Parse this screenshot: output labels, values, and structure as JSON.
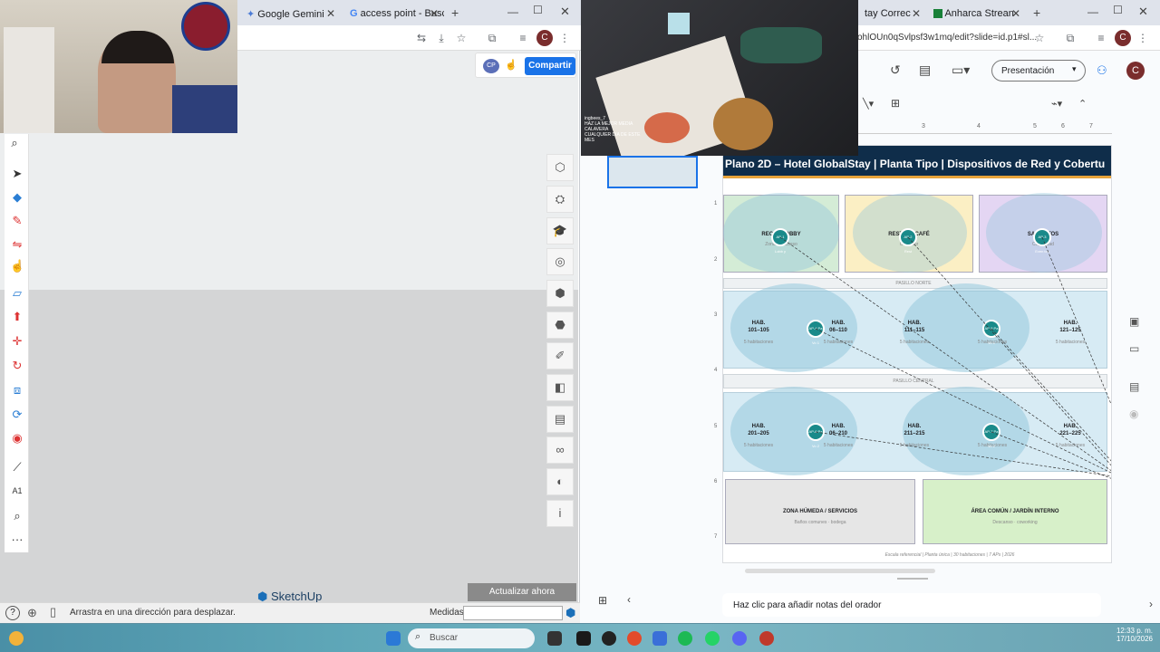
{
  "left_browser": {
    "tabs": [
      {
        "label": "Google Gemini",
        "icon": "gemini-icon"
      },
      {
        "label": "access point - Busc",
        "icon": "google-icon"
      }
    ],
    "new_tab": "+",
    "share_button": "Compartir",
    "share_avatar": "CP",
    "profile_initial": "C"
  },
  "sketchup": {
    "logo": "SketchUp",
    "update_button": "Actualizar ahora",
    "status_hint": "Arrastra en una dirección para desplazar.",
    "measures_label": "Medidas",
    "measures_value": "",
    "left_tools": [
      "search-tool",
      "select-tool",
      "eraser-tool",
      "pencil-tool",
      "line-tool",
      "rectangle-tool",
      "pushpull-tool",
      "move-tool",
      "rotate-tool",
      "scale-tool",
      "orbit-tool",
      "paint-tool",
      "tape-tool",
      "text-tool",
      "zoom-tool",
      "more-tools"
    ],
    "more_tools": "···",
    "right_tools": [
      "entity-info-icon",
      "components-icon",
      "instructor-icon",
      "materials-icon",
      "styles-icon",
      "scenes-icon",
      "outliner-icon",
      "eraser-panel-icon",
      "tags-icon",
      "display-icon",
      "glasses-icon",
      "shadows-icon",
      "info-icon"
    ],
    "info_glyph": "i"
  },
  "right_browser": {
    "tabs": [
      {
        "label": "tay Correc",
        "icon": "slides-icon"
      },
      {
        "label": "Anharca Strean",
        "icon": "sheets-icon"
      }
    ],
    "address": "ohlOUn0qSvlpsf3w1mq/edit?slide=id.p1#sl...",
    "presentation_button": "Presentación",
    "profile_initial": "C",
    "ruler_numbers": [
      "3",
      "4",
      "5",
      "6",
      "7"
    ],
    "notes_placeholder": "Haz clic para añadir notas del orador"
  },
  "slide": {
    "title": "Plano 2D – Hotel GlobalStay  |  Planta Tipo  |  Dispositivos de Red y Cobertu",
    "zones": [
      {
        "label": "RECEP      LOBBY",
        "sub": "Zona de acceso",
        "color": "#d4ecd6"
      },
      {
        "label": "RESTAU      / CAFÉ",
        "sub": "Comedor",
        "color": "#fbefc4"
      },
      {
        "label": "SALA      NTOS",
        "sub": "Capacidad",
        "color": "#e4d6f3"
      }
    ],
    "corridor_top": "PASILLO NORTE",
    "corridor_mid": "PASILLO CENTRAL",
    "rooms_row1": [
      {
        "label": "HAB.\n101–105",
        "sub": "5 habitaciones"
      },
      {
        "label": "HAB.\n06–110",
        "sub": "5 habitaciones"
      },
      {
        "label": "HAB.\n111–115",
        "sub": "5 habitaciones"
      },
      {
        "label": "",
        "sub": "5 habitaciones"
      },
      {
        "label": "HAB.\n121–125",
        "sub": "5 habitaciones"
      }
    ],
    "rooms_row2": [
      {
        "label": "HAB.\n201–205",
        "sub": "5 habitaciones"
      },
      {
        "label": "HAB.\n06–210",
        "sub": "5 habitaciones"
      },
      {
        "label": "HAB.\n211–215",
        "sub": "5 habitaciones"
      },
      {
        "label": "",
        "sub": "5 habitaciones"
      },
      {
        "label": "HAB.\n221–225",
        "sub": "5 habitaciones"
      }
    ],
    "wet_zone": {
      "label": "ZONA HÚMEDA / SERVICIOS",
      "sub": "Baños comunes · bodega"
    },
    "common_zone": {
      "label": "ÁREA COMÚN / JARDÍN INTERNO",
      "sub": "Descanso · coworking"
    },
    "footer": "Escala referencial  |  Planta única  |  30 habitaciones  |  7 APs  |  2026",
    "ap_labels": [
      "AP-1 Lobb y",
      "AP-2 Rest",
      "AP-3 Even tos",
      "AP-4 Pa Vo 1",
      "AP-5 Pa Vo 1",
      "AP-6 Pa Vo 2",
      "AP-7 Pa Vo 2"
    ],
    "left_ruler": [
      "1",
      "2",
      "3",
      "4",
      "5",
      "6",
      "7"
    ]
  },
  "camera_overlay": {
    "caption": "ingbees_7 · HAZ LA MEJOR MEDIA CALAVERA · CUALQUIER DIA DE ESTE MES",
    "caption_lines": [
      "ingbees_7",
      "HAZ LA MEJOR MEDIA",
      "CALAVERA",
      "CUALQUIER DIA DE ESTE",
      "MES"
    ]
  },
  "taskbar": {
    "search_placeholder": "Buscar",
    "time": "12:33 p. m.",
    "date": "17/10/2026"
  },
  "colors": {
    "slide_header": "#0f2d4a",
    "ap_teal": "#1a8a8a",
    "share_blue": "#1a73e8",
    "update_btn": "#8a8a8a"
  }
}
